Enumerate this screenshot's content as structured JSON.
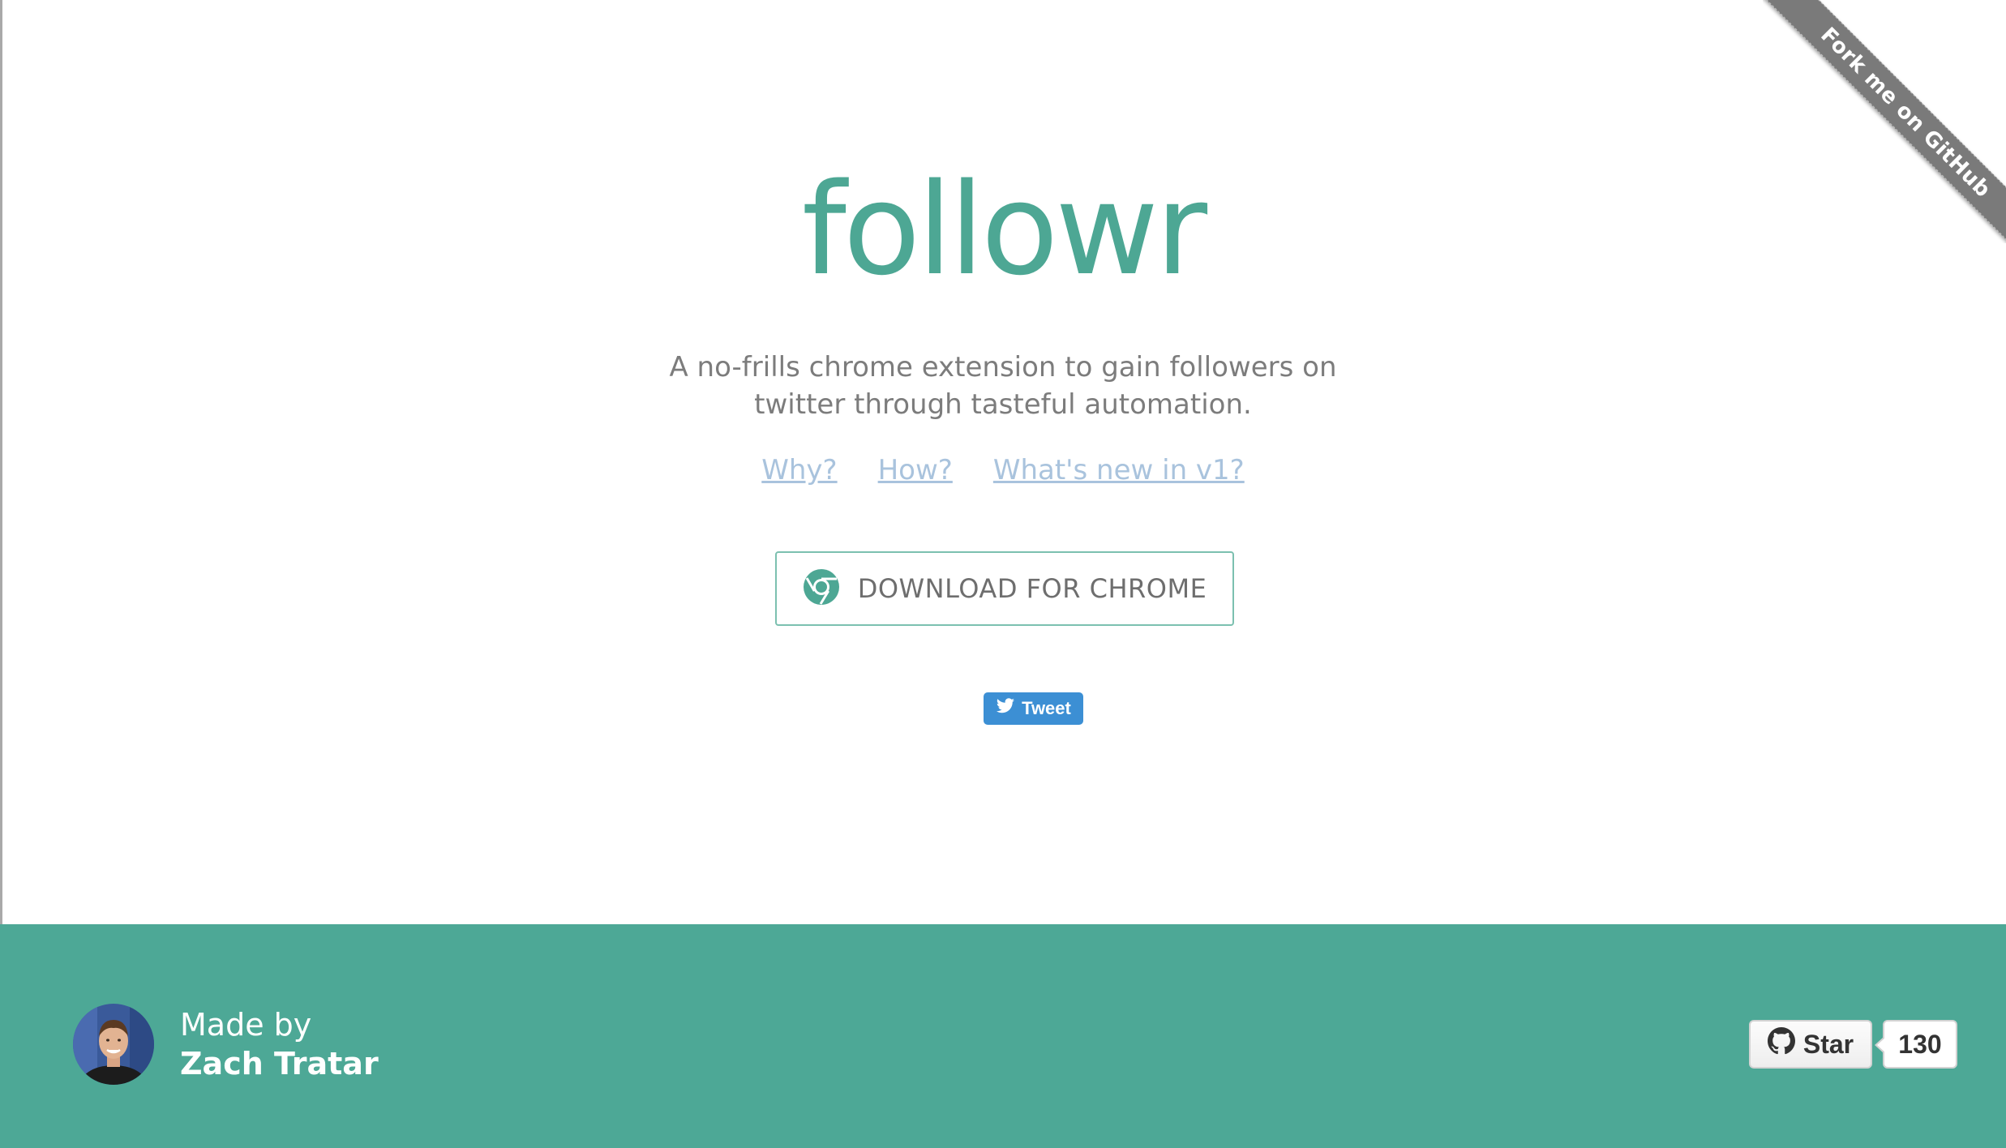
{
  "ribbon": {
    "label": "Fork me on GitHub"
  },
  "hero": {
    "logo_text": "followr",
    "tagline_line1": "A no-frills chrome extension to gain followers on",
    "tagline_line2": "twitter through tasteful automation.",
    "links": [
      {
        "label": "Why?"
      },
      {
        "label": "How?"
      },
      {
        "label": "What's new in v1?"
      }
    ],
    "download_button": {
      "label": "DOWNLOAD FOR CHROME",
      "icon": "chrome-icon"
    },
    "tweet_button": {
      "label": "Tweet",
      "icon": "twitter-bird-icon"
    }
  },
  "footer": {
    "made_by": "Made by",
    "author": "Zach Tratar",
    "github_star": {
      "label": "Star",
      "count": "130",
      "icon": "github-octocat-icon"
    }
  },
  "colors": {
    "brand": "#4da794",
    "footer_bg": "#4da896",
    "link": "#a9c3dd",
    "tweet": "#3c8fd4"
  }
}
